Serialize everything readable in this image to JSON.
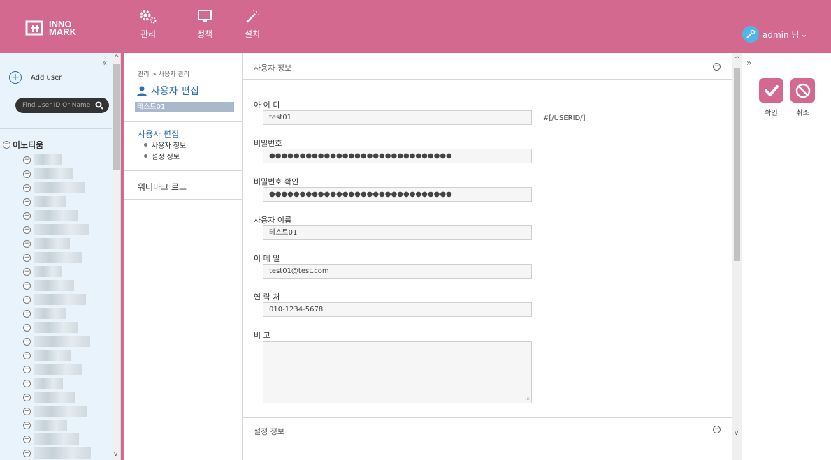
{
  "header": {
    "logo_line1": "INNO",
    "logo_line2": "MARK",
    "nav": [
      {
        "label": "관리",
        "icon": "gears-icon"
      },
      {
        "label": "정책",
        "icon": "monitor-icon"
      },
      {
        "label": "설치",
        "icon": "wand-icon"
      }
    ],
    "user_label": "admin 님",
    "user_chevron": "⌄"
  },
  "sidebar": {
    "collapse": "«",
    "add_user_label": "Add user",
    "search_placeholder": "Find User ID Or Name",
    "root_label": "이노티움",
    "root_toggle": "−"
  },
  "mid": {
    "breadcrumb": "관리 > 사용자 관리",
    "title": "사용자 편집",
    "selected_user": "테스트01",
    "section1": "사용자 편집",
    "sub1": "사용자 정보",
    "sub2": "설정 정보",
    "section2": "워터마크 로그"
  },
  "form": {
    "section1_title": "사용자 정보",
    "section2_title": "설정 정보",
    "collapse_symbol": "−",
    "id_label": "아 이 디",
    "id_value": "test01",
    "id_hint": "#[/USERID/]",
    "pw_label": "비밀번호",
    "pw_value": "●●●●●●●●●●●●●●●●●●●●●●●●●●●●●●",
    "pw_confirm_label": "비밀번호 확인",
    "pw_confirm_value": "●●●●●●●●●●●●●●●●●●●●●●●●●●●●●●",
    "name_label": "사용자 이름",
    "name_value": "테스트01",
    "email_label": "이 메 일",
    "email_value": "test01@test.com",
    "phone_label": "연 락 처",
    "phone_value": "010-1234-5678",
    "memo_label": "비 고",
    "memo_value": ""
  },
  "actions": {
    "collapse": "»",
    "confirm_label": "확인",
    "cancel_label": "취소"
  },
  "colors": {
    "brand_pink": "#d4698f",
    "accent_blue": "#2f6fb0",
    "avatar_blue": "#4fb7e6"
  }
}
